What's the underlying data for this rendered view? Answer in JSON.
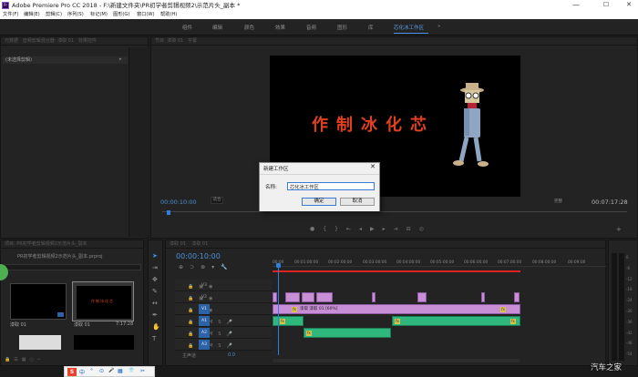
{
  "window": {
    "app_icon": "Pr",
    "title": "Adobe Premiere Pro CC 2018 - F:\\新建文件夹\\PR初学者剪辑视频2\\示范片头_副本 *",
    "minimize": "—",
    "maximize": "☐",
    "close": "✕"
  },
  "menu": [
    "文件(F)",
    "编辑(E)",
    "剪辑(C)",
    "序列(S)",
    "标记(M)",
    "图形(G)",
    "窗口(W)",
    "帮助(H)"
  ],
  "workspaces": {
    "items": [
      "组件",
      "编辑",
      "颜色",
      "效果",
      "音频",
      "图形",
      "库",
      "芯化冰工作区"
    ],
    "active_index": 7,
    "more": "»"
  },
  "source_panel": {
    "tabs": [
      "元数据",
      "音频剪辑混合器: 漆取 01",
      "效果控件",
      "Lumetri 范围"
    ],
    "empty_label": "(未选择剪辑)"
  },
  "program_panel": {
    "tabs": [
      "节目: 漆取 01",
      "字幕"
    ],
    "overlay_text": "作制冰化芯",
    "timecode_left": "00:00:10:00",
    "timecode_right": "00:07:17:28",
    "fit": "适合",
    "full": "完整"
  },
  "dialog": {
    "title": "新建工作区",
    "close": "✕",
    "name_label": "名称:",
    "name_value": "芯化冰工作区",
    "ok_label": "确定",
    "cancel_label": "取消"
  },
  "project_panel": {
    "tabs": [
      "项目: PR初学者剪辑视频2示范片头_副本",
      "媒体浏览器",
      "库",
      "信息"
    ],
    "project_file": "PR初学者剪辑视频2示范片头_副本.prproj",
    "items": [
      {
        "name": "漆取 01",
        "duration": ""
      },
      {
        "name": "漆取 01",
        "duration": "7:17:28"
      }
    ]
  },
  "timeline": {
    "tabs": [
      "漆取 01",
      "漆取 01"
    ],
    "timecode": "00:00:10:00",
    "ruler": [
      "00:00",
      "00:01:00:00",
      "00:02:00:00",
      "00:03:00:00",
      "00:04:00:00",
      "00:05:00:00",
      "00:06:00:00",
      "00:07:00:00",
      "00:08:00:00",
      "00:09:00"
    ],
    "video_tracks": [
      "V3",
      "V2",
      "V1"
    ],
    "audio_tracks": [
      "A1",
      "A2",
      "A3"
    ],
    "master_label": "主声道",
    "master_value": "0.0",
    "v1_clip_label": "漆取 漆取 01 [60%]",
    "fx_badge": "fx"
  },
  "meter": {
    "scale": [
      "0",
      "-6",
      "-12",
      "-18",
      "-24",
      "-30",
      "-36",
      "-42",
      "-48",
      "-54"
    ],
    "bottom": "dB"
  },
  "taskbar": {
    "items": [
      "S",
      "中",
      "°",
      "⊙",
      "🎤",
      "▦",
      "👕",
      "✂"
    ]
  },
  "watermark": "汽车之家",
  "colors": {
    "accent_blue": "#4a90e2",
    "video_clip": "#c98fd6",
    "audio_clip": "#2fb77e",
    "overlay_text": "#e04020",
    "playhead": "#2f7fe0",
    "work_area": "#d22"
  }
}
